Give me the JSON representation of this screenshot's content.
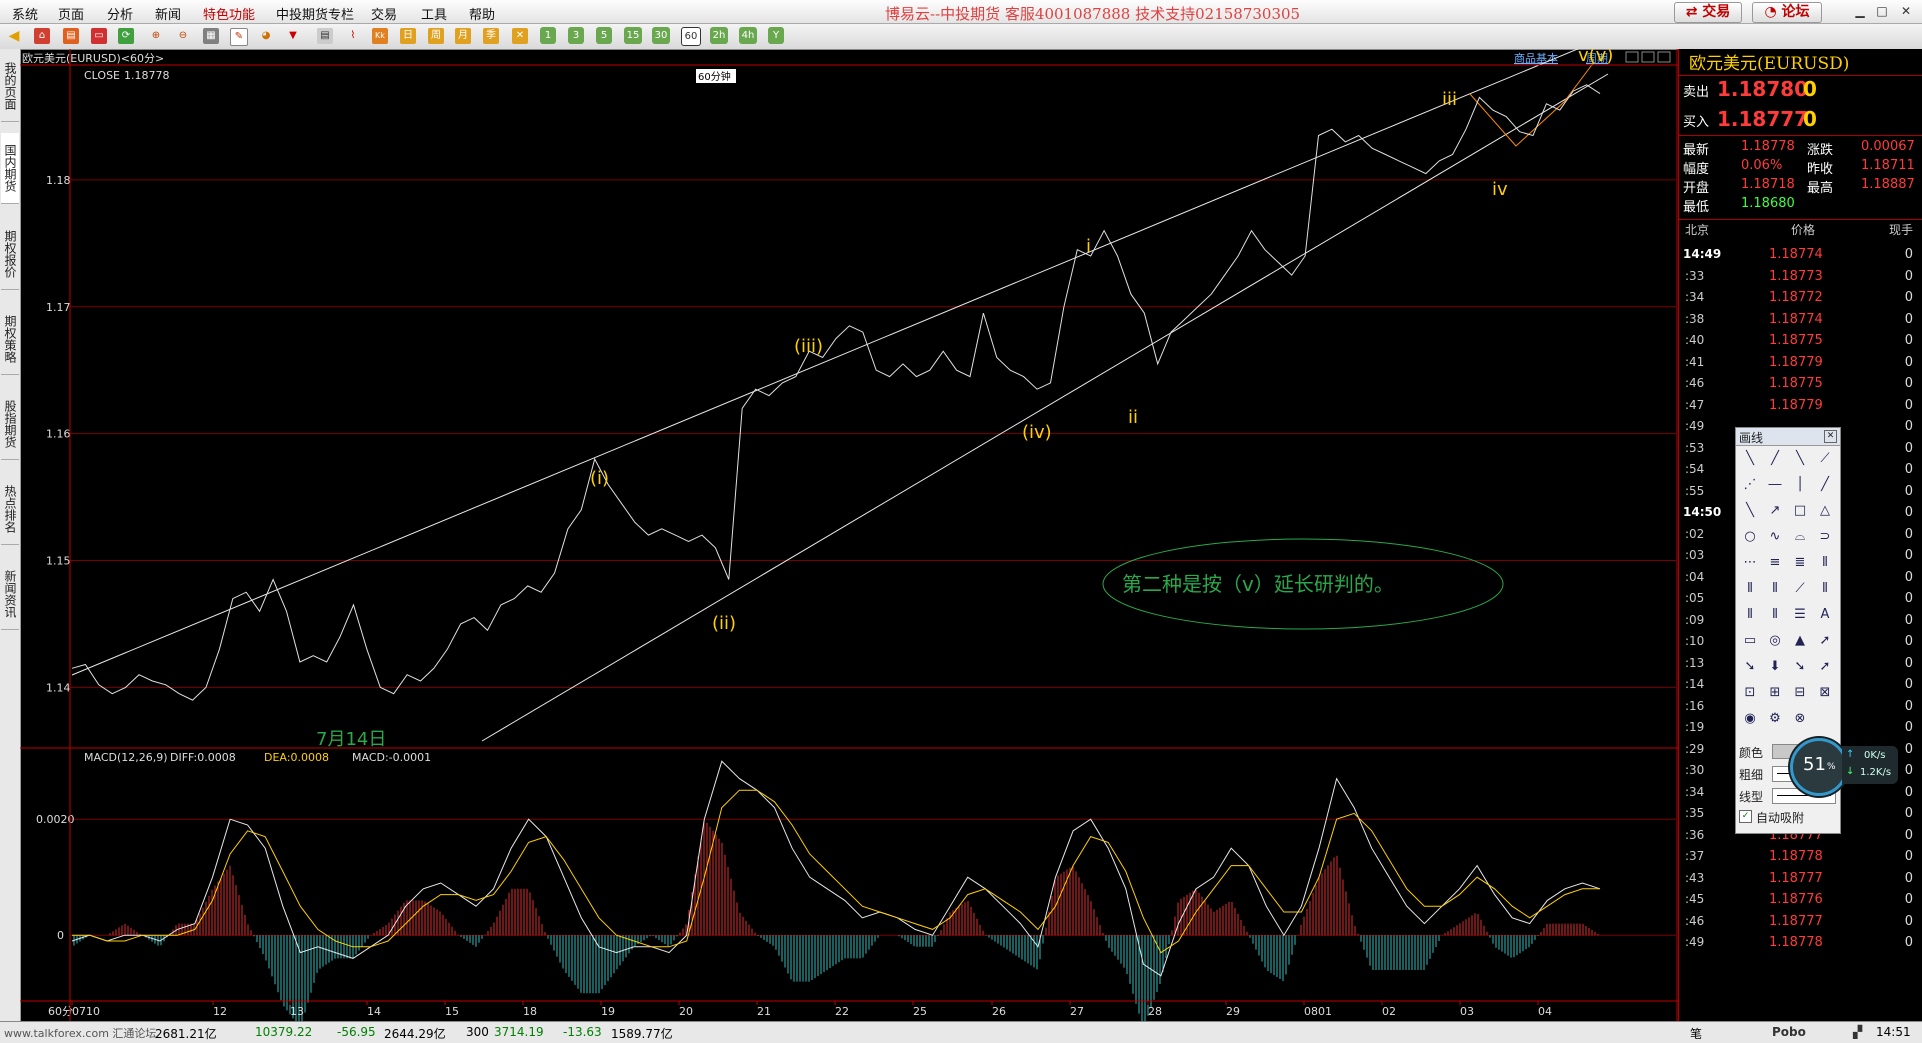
{
  "menu": [
    "系统",
    "页面",
    "分析",
    "新闻",
    "特色功能",
    "中投期货专栏",
    "交易",
    "工具",
    "帮助"
  ],
  "brand": "博易云--中投期货 客服4001087888 技术支持02158730305",
  "top_buttons": {
    "trade": "交易",
    "forum": "论坛"
  },
  "toolbar_periods": [
    "1",
    "3",
    "5",
    "15",
    "30",
    "60",
    "2h",
    "4h",
    "Y"
  ],
  "left_tabs": [
    "我的页面",
    "国内期货",
    "期权报价",
    "期权策略",
    "股指期货",
    "热点排名",
    "新闻资讯"
  ],
  "chart_header": {
    "title": "欧元美元(EURUSD)<60分>",
    "close_label": "CLOSE",
    "close_value": "1.18778",
    "period_badge": "60分钟"
  },
  "chart_links": {
    "info": "商品基本",
    "cycle": "周期"
  },
  "annotation": "第二种是按（v）延长研判的。",
  "date_note": "7月14日",
  "wave_labels": [
    "(i)",
    "(ii)",
    "(iii)",
    "(iv)",
    "v(v)",
    "i",
    "ii",
    "iii",
    "iv"
  ],
  "macd_header": {
    "label": "MACD(12,26,9)",
    "diff": "DIFF:0.0008",
    "dea": "DEA:0.0008",
    "macd": "MACD:-0.0001"
  },
  "period_label": "60分",
  "chart_data": {
    "type": "line",
    "title": "欧元美元(EURUSD)",
    "xlabel": "",
    "ylabel": "",
    "x_ticks": [
      "0710",
      "12",
      "13",
      "14",
      "15",
      "18",
      "19",
      "20",
      "21",
      "22",
      "25",
      "26",
      "27",
      "28",
      "29",
      "0801",
      "02",
      "03",
      "04"
    ],
    "y_ticks": [
      "1.14",
      "1.15",
      "1.16",
      "1.17",
      "1.18"
    ],
    "ylim": [
      1.1353,
      1.1889
    ],
    "series": [
      {
        "values": [
          1.1415,
          1.1418,
          1.1402,
          1.1395,
          1.14,
          1.141,
          1.1405,
          1.1402,
          1.1395,
          1.139,
          1.14,
          1.143,
          1.147,
          1.1475,
          1.146,
          1.1485,
          1.146,
          1.142,
          1.1425,
          1.142,
          1.144,
          1.1465,
          1.143,
          1.14,
          1.1395,
          1.141,
          1.1405,
          1.1415,
          1.143,
          1.145,
          1.1455,
          1.1445,
          1.1465,
          1.147,
          1.148,
          1.1475,
          1.149,
          1.1525,
          1.154,
          1.158,
          1.156,
          1.1545,
          1.153,
          1.152,
          1.1525,
          1.152,
          1.1515,
          1.152,
          1.151,
          1.1485,
          1.162,
          1.1635,
          1.163,
          1.164,
          1.1645,
          1.1665,
          1.166,
          1.1675,
          1.1685,
          1.168,
          1.165,
          1.1645,
          1.1655,
          1.1645,
          1.165,
          1.1665,
          1.165,
          1.1645,
          1.1695,
          1.166,
          1.165,
          1.1645,
          1.1635,
          1.164,
          1.17,
          1.1745,
          1.174,
          1.176,
          1.174,
          1.171,
          1.1695,
          1.1655,
          1.168,
          1.169,
          1.17,
          1.171,
          1.1725,
          1.174,
          1.176,
          1.1745,
          1.1735,
          1.1725,
          1.174,
          1.1835,
          1.184,
          1.183,
          1.1835,
          1.1825,
          1.182,
          1.1815,
          1.181,
          1.1805,
          1.1815,
          1.182,
          1.184,
          1.1865,
          1.1855,
          1.185,
          1.1838,
          1.1835,
          1.186,
          1.1855,
          1.187,
          1.1875,
          1.1868
        ]
      }
    ],
    "macd_ylim": [
      -0.0011,
      0.0029
    ],
    "macd_ticks": [
      "0.0020",
      "0"
    ],
    "diff": [
      -0.0001,
      0.0,
      -0.0001,
      0.0,
      0.0,
      -0.0001,
      0.0001,
      0.0002,
      0.001,
      0.002,
      0.0019,
      0.0015,
      0.0005,
      -0.0003,
      -0.0002,
      -0.0003,
      -0.0004,
      -0.0002,
      0.0,
      0.0005,
      0.0008,
      0.0009,
      0.0007,
      0.0005,
      0.0008,
      0.0015,
      0.002,
      0.0017,
      0.001,
      0.0003,
      -0.0002,
      -0.0003,
      -0.0002,
      -0.0002,
      -0.0003,
      0.0,
      0.002,
      0.003,
      0.0027,
      0.0025,
      0.0022,
      0.0015,
      0.001,
      0.0008,
      0.0006,
      0.0003,
      0.0004,
      0.0003,
      0.0001,
      0.0,
      0.0005,
      0.001,
      0.0008,
      0.0005,
      0.0002,
      -0.0002,
      0.001,
      0.0018,
      0.002,
      0.0015,
      0.0008,
      -0.0005,
      -0.0007,
      0.0002,
      0.0008,
      0.001,
      0.0015,
      0.0012,
      0.0005,
      0.0,
      0.0005,
      0.0015,
      0.0027,
      0.0022,
      0.0015,
      0.001,
      0.0005,
      0.0002,
      0.0005,
      0.0008,
      0.0012,
      0.0007,
      0.0003,
      0.0002,
      0.0006,
      0.0008,
      0.0009,
      0.0008
    ],
    "dea": [
      0.0,
      0.0,
      -0.0001,
      -0.0001,
      0.0,
      0.0,
      0.0,
      0.0001,
      0.0006,
      0.0014,
      0.0018,
      0.0017,
      0.0011,
      0.0005,
      0.0001,
      -0.0001,
      -0.0002,
      -0.0002,
      -0.0001,
      0.0002,
      0.0005,
      0.0007,
      0.0007,
      0.0006,
      0.0007,
      0.0011,
      0.0016,
      0.0017,
      0.0013,
      0.0008,
      0.0003,
      0.0,
      -0.0001,
      -0.0002,
      -0.0002,
      -0.0001,
      0.001,
      0.0022,
      0.0025,
      0.0025,
      0.0023,
      0.0019,
      0.0014,
      0.0011,
      0.0008,
      0.0005,
      0.0004,
      0.0003,
      0.0002,
      0.0001,
      0.0003,
      0.0007,
      0.0008,
      0.0006,
      0.0004,
      0.0001,
      0.0005,
      0.0012,
      0.0017,
      0.0016,
      0.0011,
      0.0003,
      -0.0003,
      -0.0001,
      0.0004,
      0.0008,
      0.0012,
      0.0012,
      0.0008,
      0.0004,
      0.0004,
      0.001,
      0.002,
      0.0021,
      0.0018,
      0.0013,
      0.0008,
      0.0005,
      0.0005,
      0.0007,
      0.001,
      0.0008,
      0.0005,
      0.0003,
      0.0005,
      0.0007,
      0.0008,
      0.0008
    ]
  },
  "quote": {
    "name": "欧元美元(EURUSD)",
    "sell_label": "卖出",
    "sell_value": "1.18780",
    "sell_vol": "0",
    "buy_label": "买入",
    "buy_value": "1.18777",
    "buy_vol": "0",
    "rows": [
      {
        "k1": "最新",
        "v1": "1.18778",
        "k2": "涨跌",
        "v2": "0.00067"
      },
      {
        "k1": "幅度",
        "v1": "0.06%",
        "k2": "昨收",
        "v2": "1.18711"
      },
      {
        "k1": "开盘",
        "v1": "1.18718",
        "k2": "最高",
        "v2": "1.18887"
      },
      {
        "k1": "最低",
        "v1": "1.18680",
        "k2": "",
        "v2": ""
      }
    ],
    "tick_header": {
      "time": "北京",
      "price": "价格",
      "vol": "现手"
    },
    "ticks": [
      {
        "t": "14:49",
        "p": "1.18774",
        "v": "0"
      },
      {
        "t": ":33",
        "p": "1.18773",
        "v": "0"
      },
      {
        "t": ":34",
        "p": "1.18772",
        "v": "0"
      },
      {
        "t": ":38",
        "p": "1.18774",
        "v": "0"
      },
      {
        "t": ":40",
        "p": "1.18775",
        "v": "0"
      },
      {
        "t": ":41",
        "p": "1.18779",
        "v": "0"
      },
      {
        "t": ":46",
        "p": "1.18775",
        "v": "0"
      },
      {
        "t": ":47",
        "p": "1.18779",
        "v": "0"
      },
      {
        "t": ":49",
        "p": "",
        "v": "0"
      },
      {
        "t": ":53",
        "p": "",
        "v": "0"
      },
      {
        "t": ":54",
        "p": "",
        "v": "0"
      },
      {
        "t": ":55",
        "p": "",
        "v": "0"
      },
      {
        "t": "14:50",
        "p": "",
        "v": "0"
      },
      {
        "t": ":02",
        "p": "",
        "v": "0"
      },
      {
        "t": ":03",
        "p": "",
        "v": "0"
      },
      {
        "t": ":04",
        "p": "",
        "v": "0"
      },
      {
        "t": ":05",
        "p": "",
        "v": "0"
      },
      {
        "t": ":09",
        "p": "",
        "v": "0"
      },
      {
        "t": ":10",
        "p": "",
        "v": "0"
      },
      {
        "t": ":13",
        "p": "",
        "v": "0"
      },
      {
        "t": ":14",
        "p": "",
        "v": "0"
      },
      {
        "t": ":16",
        "p": "",
        "v": "0"
      },
      {
        "t": ":19",
        "p": "",
        "v": "0"
      },
      {
        "t": ":29",
        "p": "",
        "v": "0"
      },
      {
        "t": ":30",
        "p": "",
        "v": "0"
      },
      {
        "t": ":34",
        "p": "",
        "v": "0"
      },
      {
        "t": ":35",
        "p": "1.18776",
        "v": "0"
      },
      {
        "t": ":36",
        "p": "1.18777",
        "v": "0"
      },
      {
        "t": ":37",
        "p": "1.18778",
        "v": "0"
      },
      {
        "t": ":43",
        "p": "1.18777",
        "v": "0"
      },
      {
        "t": ":45",
        "p": "1.18776",
        "v": "0"
      },
      {
        "t": ":46",
        "p": "1.18777",
        "v": "0"
      },
      {
        "t": ":49",
        "p": "1.18778",
        "v": "0"
      }
    ]
  },
  "palette": {
    "title": "画线",
    "color_label": "颜色",
    "width_label": "粗细",
    "style_label": "线型",
    "auto_label": "自动吸附"
  },
  "speed": {
    "percent": "51",
    "unit": "%",
    "up": "0K/s",
    "down": "1.2K/s"
  },
  "statusbar": {
    "pen": "笔",
    "items": [
      "2681.21亿",
      "10379.22",
      "-56.95",
      "2644.29亿",
      "300",
      "3714.19",
      "-13.63",
      "1589.77亿"
    ],
    "pobo": "Pobo",
    "time": "14:51",
    "watermark": "www.talkforex.com 汇通论坛"
  }
}
